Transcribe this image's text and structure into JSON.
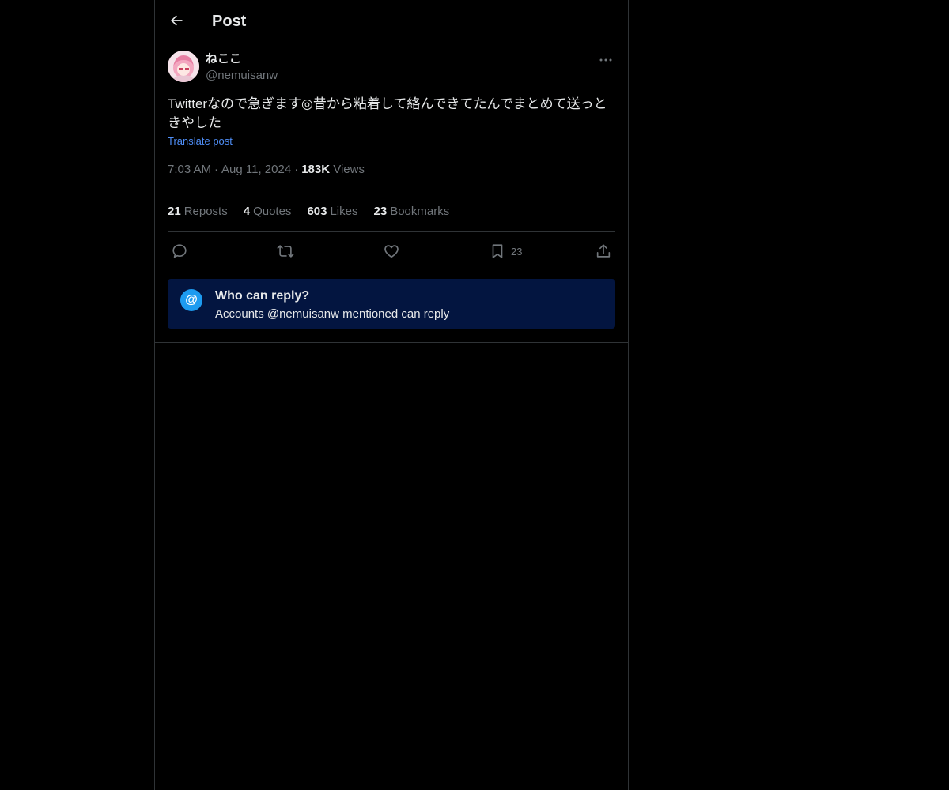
{
  "header": {
    "title": "Post",
    "back_icon": "arrow-left-icon"
  },
  "post": {
    "display_name": "ねここ",
    "handle": "@nemuisanw",
    "text": "Twitterなので急ぎます◎昔から粘着して絡んできてたんでまとめて送っときやした",
    "translate_label": "Translate post",
    "time": "7:03 AM",
    "date": "Aug 11, 2024",
    "views_count": "183K",
    "views_label": "Views",
    "separator": "·"
  },
  "stats": {
    "reposts_count": "21",
    "reposts_label": "Reposts",
    "quotes_count": "4",
    "quotes_label": "Quotes",
    "likes_count": "603",
    "likes_label": "Likes",
    "bookmarks_count": "23",
    "bookmarks_label": "Bookmarks"
  },
  "actions": {
    "reply_icon": "reply-icon",
    "repost_icon": "repost-icon",
    "like_icon": "heart-icon",
    "bookmark_icon": "bookmark-icon",
    "bookmark_count": "23",
    "share_icon": "share-icon"
  },
  "reply_restriction": {
    "icon_glyph": "@",
    "title": "Who can reply?",
    "subtitle": "Accounts @nemuisanw mentioned can reply"
  },
  "colors": {
    "background": "#000000",
    "text": "#e7e9ea",
    "muted": "#71767b",
    "link": "#4f8ef7",
    "accent": "#1d9bf0",
    "reply_box_bg": "#031540",
    "border": "#2f3336"
  }
}
